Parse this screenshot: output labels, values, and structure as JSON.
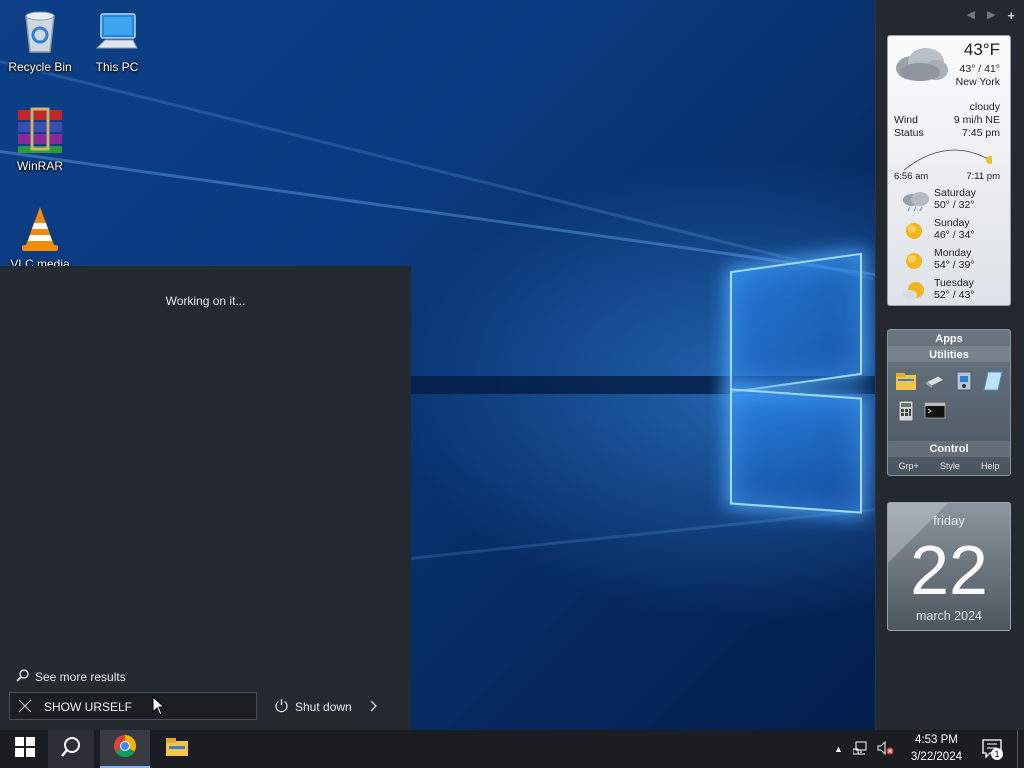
{
  "desktop": {
    "icons": [
      {
        "label": "Recycle Bin",
        "icon": "recycle-bin-icon"
      },
      {
        "label": "This PC",
        "icon": "computer-icon"
      },
      {
        "label": "WinRAR",
        "icon": "winrar-icon"
      },
      {
        "label": "VLC media",
        "icon": "vlc-icon"
      }
    ]
  },
  "search_panel": {
    "status": "Working on it...",
    "see_more": "See more results",
    "query": "SHOW URSELF",
    "shutdown_label": "Shut down"
  },
  "sidebar": {
    "weather": {
      "temp": "43°F",
      "hilo": "43° / 41°",
      "city": "New York",
      "condition": "cloudy",
      "wind_label": "Wind",
      "wind_value": "9 mi/h NE",
      "status_label": "Status",
      "status_value": "7:45 pm",
      "sunrise": "6:56 am",
      "sunset": "7:11 pm",
      "forecast": [
        {
          "day": "Saturday",
          "range": "50° / 32°",
          "icon": "rain-cloud-icon"
        },
        {
          "day": "Sunday",
          "range": "46° / 34°",
          "icon": "sun-icon"
        },
        {
          "day": "Monday",
          "range": "54° / 39°",
          "icon": "sun-icon"
        },
        {
          "day": "Tuesday",
          "range": "52° / 43°",
          "icon": "partly-sunny-icon"
        }
      ]
    },
    "apps": {
      "title": "Apps",
      "utilities": "Utilities",
      "control": "Control",
      "links": [
        "Grp+",
        "Style",
        "Help"
      ]
    },
    "calendar": {
      "weekday": "friday",
      "day": "22",
      "month_year": "march 2024"
    }
  },
  "taskbar": {
    "time": "4:53 PM",
    "date": "3/22/2024",
    "notifications": "1"
  },
  "colors": {
    "accent": "#0a64c8",
    "panel": "#252a30",
    "taskbar": "#1a1d21"
  }
}
